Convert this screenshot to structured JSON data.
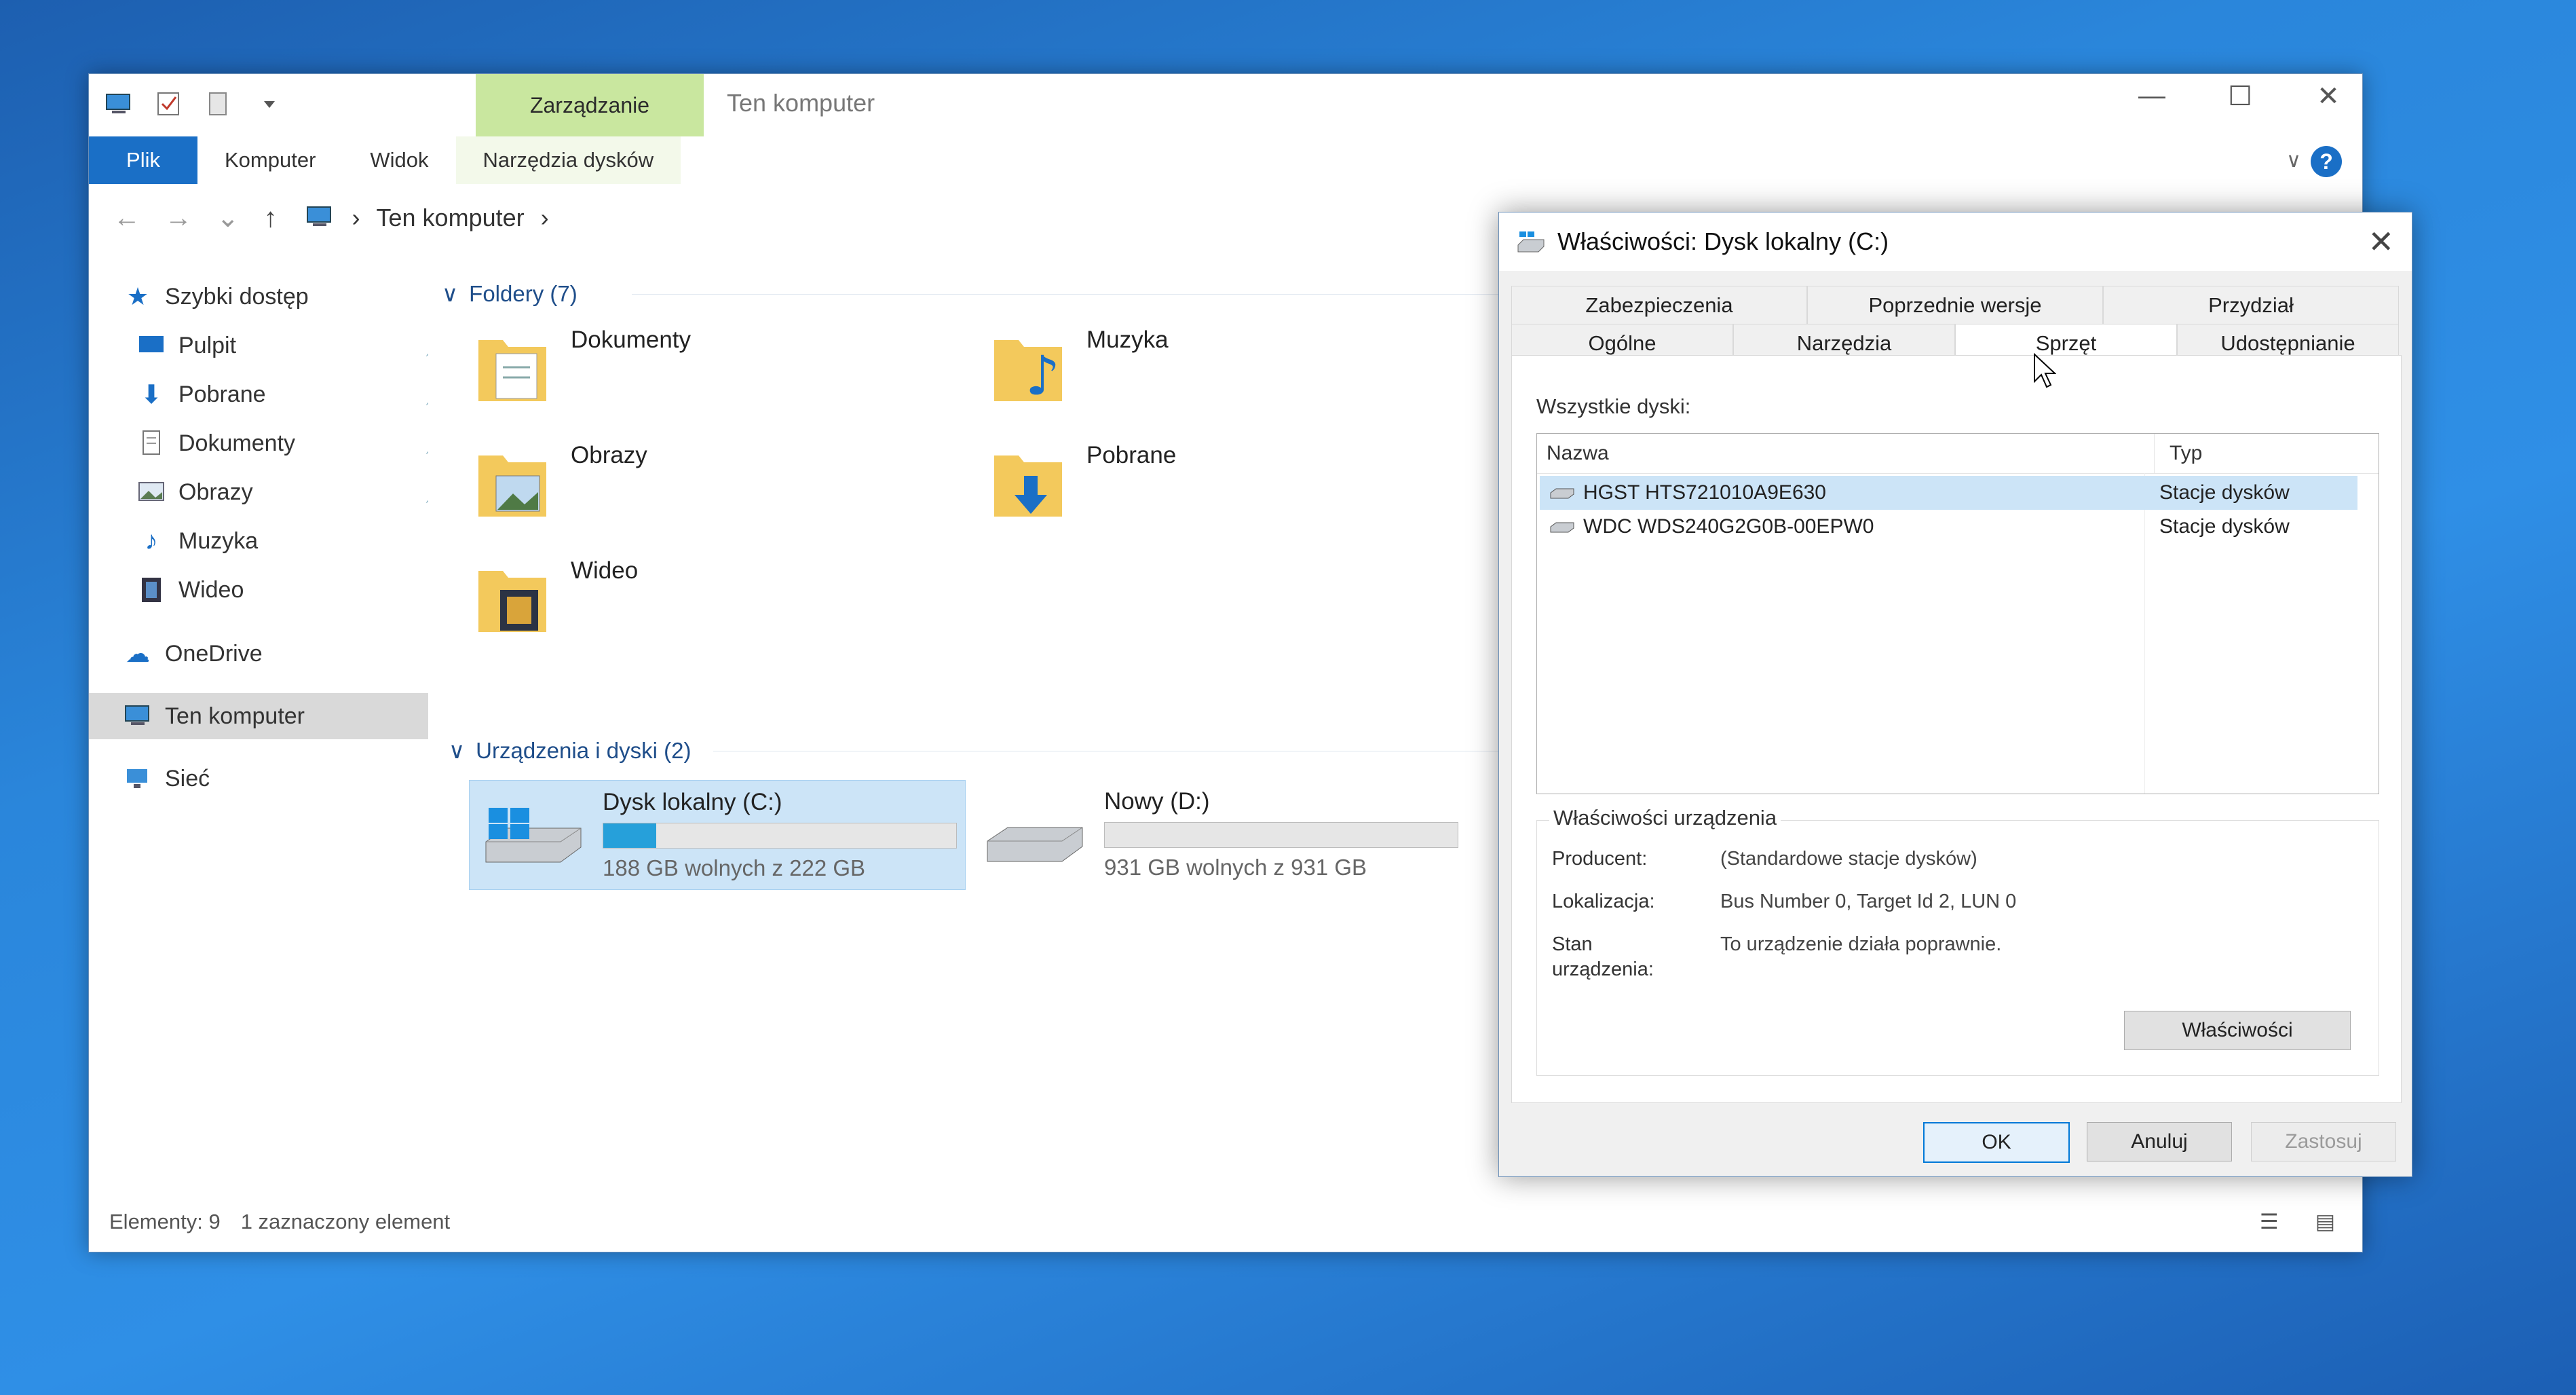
{
  "explorer": {
    "title": "Ten komputer",
    "manage_tab": "Zarządzanie",
    "ribbon_tabs": [
      "Plik",
      "Komputer",
      "Widok",
      "Narzędzia dysków"
    ],
    "help_label": "?",
    "breadcrumb": "Ten komputer",
    "sidebar": {
      "quick_access": "Szybki dostęp",
      "items": [
        "Pulpit",
        "Pobrane",
        "Dokumenty",
        "Obrazy",
        "Muzyka",
        "Wideo"
      ],
      "onedrive": "OneDrive",
      "this_pc": "Ten komputer",
      "network": "Sieć"
    },
    "folders_header": "Foldery (7)",
    "folders": [
      "Dokumenty",
      "Muzyka",
      "Obrazy",
      "Pobrane",
      "Wideo"
    ],
    "devices_header": "Urządzenia i dyski (2)",
    "drives": [
      {
        "name": "Dysk lokalny (C:)",
        "free": "188 GB wolnych z 222 GB",
        "used_fraction": 0.15
      },
      {
        "name": "Nowy (D:)",
        "free": "931 GB wolnych z 931 GB",
        "used_fraction": 0.0
      }
    ],
    "status": {
      "items": "Elementy: 9",
      "selected": "1 zaznaczony element"
    }
  },
  "dialog": {
    "title": "Właściwości: Dysk lokalny (C:)",
    "tabs_top": [
      "Zabezpieczenia",
      "Poprzednie wersje",
      "Przydział"
    ],
    "tabs_bottom": [
      "Ogólne",
      "Narzędzia",
      "Sprzęt",
      "Udostępnianie"
    ],
    "all_disks_label": "Wszystkie dyski:",
    "columns": [
      "Nazwa",
      "Typ"
    ],
    "disks": [
      {
        "name": "HGST HTS721010A9E630",
        "type": "Stacje dysków"
      },
      {
        "name": "WDC WDS240G2G0B-00EPW0",
        "type": "Stacje dysków"
      }
    ],
    "device_props_title": "Właściwości urządzenia",
    "props": {
      "manufacturer_label": "Producent:",
      "manufacturer": "(Standardowe stacje dysków)",
      "location_label": "Lokalizacja:",
      "location": "Bus Number 0, Target Id 2, LUN 0",
      "status_label_1": "Stan",
      "status_label_2": "urządzenia:",
      "status": "To urządzenie działa poprawnie."
    },
    "properties_button": "Właściwości",
    "ok": "OK",
    "cancel": "Anuluj",
    "apply": "Zastosuj"
  }
}
